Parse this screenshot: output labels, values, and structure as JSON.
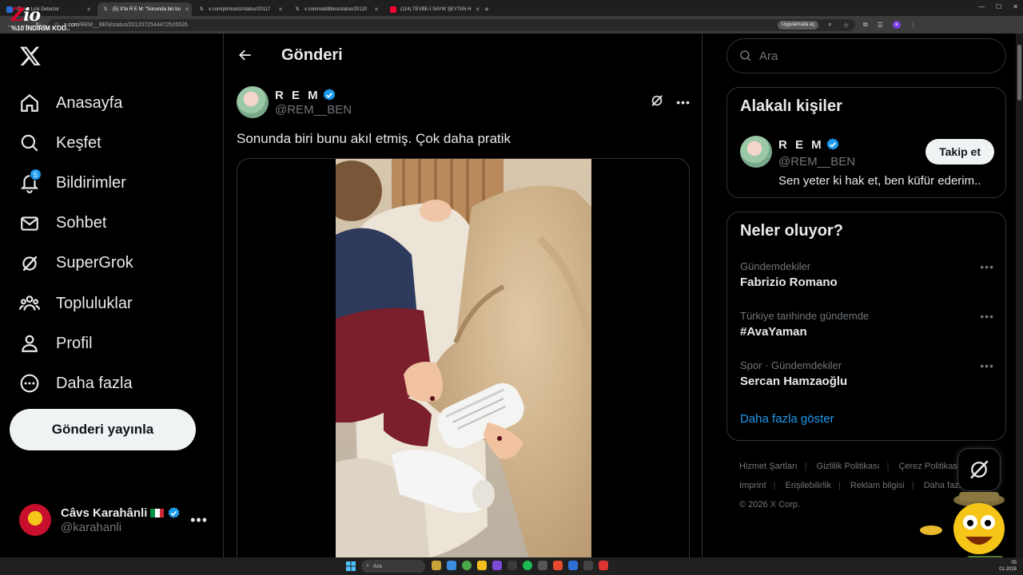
{
  "browser": {
    "tabs": [
      {
        "label": "Ghost Link Detector",
        "active": false
      },
      {
        "label": "(5) X'te R E M: \"Sonunda biri bu",
        "active": true
      },
      {
        "label": "x.com/ptmiceriz/status/20117",
        "active": false
      },
      {
        "label": "x.com/redditbos/status/20120",
        "active": false
      },
      {
        "label": "(114) TEVBE-İ SAYIK ŞEYTAN H",
        "active": false
      }
    ],
    "new_tab": "+",
    "url_host": "x.com",
    "url_path": "/REM__BEN/status/2012072544472526526",
    "app_badge": "Uygulamada aç",
    "profile_letter": "e"
  },
  "promo": {
    "logo_main": "Z",
    "logo_rest": "io",
    "text": "%10 İNDİRİM KOD.."
  },
  "sidebar": {
    "items": [
      {
        "label": "Anasayfa",
        "icon": "home-icon"
      },
      {
        "label": "Keşfet",
        "icon": "search-icon"
      },
      {
        "label": "Bildirimler",
        "icon": "bell-icon",
        "badge": "5"
      },
      {
        "label": "Sohbet",
        "icon": "mail-icon"
      },
      {
        "label": "SuperGrok",
        "icon": "grok-icon"
      },
      {
        "label": "Topluluklar",
        "icon": "communities-icon"
      },
      {
        "label": "Profil",
        "icon": "person-icon"
      },
      {
        "label": "Daha fazla",
        "icon": "more-circle-icon"
      }
    ],
    "post_button": "Gönderi yayınla",
    "account": {
      "name": "Câvs Karahânli",
      "handle": "@karahanli",
      "more": "•••"
    }
  },
  "main": {
    "title": "Gönderi",
    "tweet": {
      "author_name": "R E M",
      "author_handle": "@REM__BEN",
      "text": "Sonunda biri bunu akıl etmiş. Çok daha pratik",
      "more": "•••"
    }
  },
  "right": {
    "search_placeholder": "Ara",
    "relevant": {
      "title": "Alakalı kişiler",
      "name": "R E M",
      "handle": "@REM__BEN",
      "bio": "Sen yeter ki hak et, ben küfür ederim..",
      "follow_label": "Takip et"
    },
    "trends": {
      "title": "Neler oluyor?",
      "items": [
        {
          "category": "Gündemdekiler",
          "name": "Fabrizio Romano"
        },
        {
          "category": "Türkiye tarihinde gündemde",
          "name": "#AvaYaman"
        },
        {
          "category": "Spor · Gündemdekiler",
          "name": "Sercan Hamzaoğlu"
        }
      ],
      "more_dots": "•••",
      "show_more": "Daha fazla göster"
    },
    "footer": {
      "links": [
        "Hizmet Şartları",
        "Gizlilik Politikası",
        "Çerez Politikası",
        "Imprint",
        "Erişilebilirlik",
        "Reklam bilgisi",
        "Daha fazla"
      ],
      "separator": "|",
      "copyright": "© 2026 X Corp."
    }
  },
  "taskbar": {
    "search_label": "Ara",
    "clock_time": "05",
    "clock_date": "01.2026"
  },
  "colors": {
    "accent": "#1d9bf0",
    "background": "#000000",
    "border": "#2f3336",
    "muted_text": "#71767b"
  }
}
